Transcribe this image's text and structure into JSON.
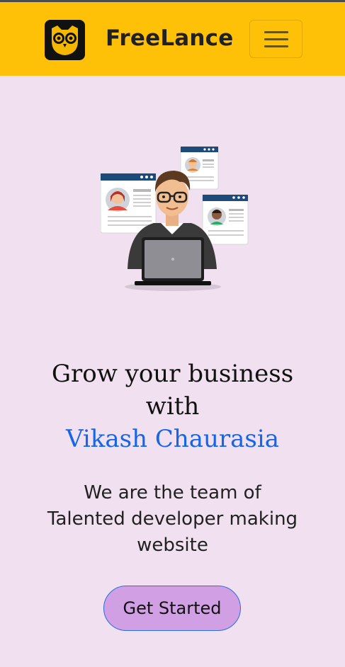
{
  "navbar": {
    "brand": "FreeLance",
    "logo_icon": "owl-logo-icon",
    "menu_icon": "hamburger-menu-icon"
  },
  "hero": {
    "headline_line1": "Grow your business",
    "headline_line2": "with",
    "headline_name": "Vikash Chaurasia",
    "subtitle_line1": "We are the team of",
    "subtitle_line2": "Talented developer making",
    "subtitle_line3": "website",
    "cta_label": "Get Started",
    "illustration": "freelancer-laptop-illustration"
  },
  "colors": {
    "navbar_bg": "#ffc107",
    "page_bg": "#f1e0f0",
    "accent_name": "#1565e8",
    "cta_bg": "#d19fe4"
  }
}
